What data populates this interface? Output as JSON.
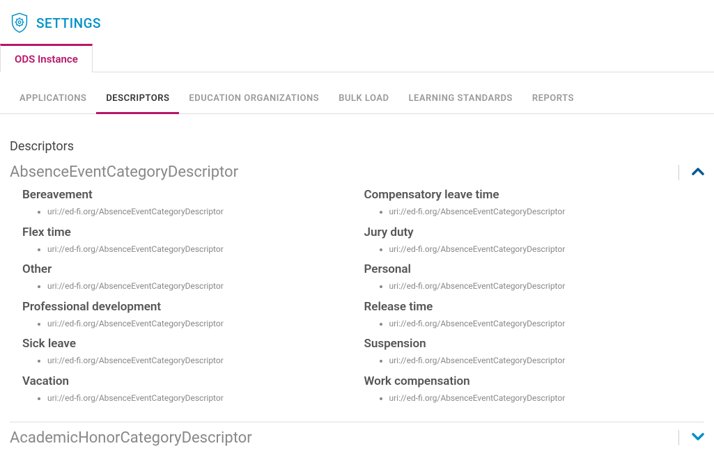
{
  "header": {
    "title": "SETTINGS"
  },
  "mainTab": {
    "label": "ODS Instance"
  },
  "subTabs": [
    {
      "label": "APPLICATIONS",
      "active": false
    },
    {
      "label": "DESCRIPTORS",
      "active": true
    },
    {
      "label": "EDUCATION ORGANIZATIONS",
      "active": false
    },
    {
      "label": "BULK LOAD",
      "active": false
    },
    {
      "label": "LEARNING STANDARDS",
      "active": false
    },
    {
      "label": "REPORTS",
      "active": false
    }
  ],
  "sectionTitle": "Descriptors",
  "descriptors": [
    {
      "name": "AbsenceEventCategoryDescriptor",
      "expanded": true,
      "items": [
        {
          "name": "Bereavement",
          "uri": "uri://ed-fi.org/AbsenceEventCategoryDescriptor"
        },
        {
          "name": "Compensatory leave time",
          "uri": "uri://ed-fi.org/AbsenceEventCategoryDescriptor"
        },
        {
          "name": "Flex time",
          "uri": "uri://ed-fi.org/AbsenceEventCategoryDescriptor"
        },
        {
          "name": "Jury duty",
          "uri": "uri://ed-fi.org/AbsenceEventCategoryDescriptor"
        },
        {
          "name": "Other",
          "uri": "uri://ed-fi.org/AbsenceEventCategoryDescriptor"
        },
        {
          "name": "Personal",
          "uri": "uri://ed-fi.org/AbsenceEventCategoryDescriptor"
        },
        {
          "name": "Professional development",
          "uri": "uri://ed-fi.org/AbsenceEventCategoryDescriptor"
        },
        {
          "name": "Release time",
          "uri": "uri://ed-fi.org/AbsenceEventCategoryDescriptor"
        },
        {
          "name": "Sick leave",
          "uri": "uri://ed-fi.org/AbsenceEventCategoryDescriptor"
        },
        {
          "name": "Suspension",
          "uri": "uri://ed-fi.org/AbsenceEventCategoryDescriptor"
        },
        {
          "name": "Vacation",
          "uri": "uri://ed-fi.org/AbsenceEventCategoryDescriptor"
        },
        {
          "name": "Work compensation",
          "uri": "uri://ed-fi.org/AbsenceEventCategoryDescriptor"
        }
      ]
    },
    {
      "name": "AcademicHonorCategoryDescriptor",
      "expanded": false,
      "items": []
    }
  ]
}
